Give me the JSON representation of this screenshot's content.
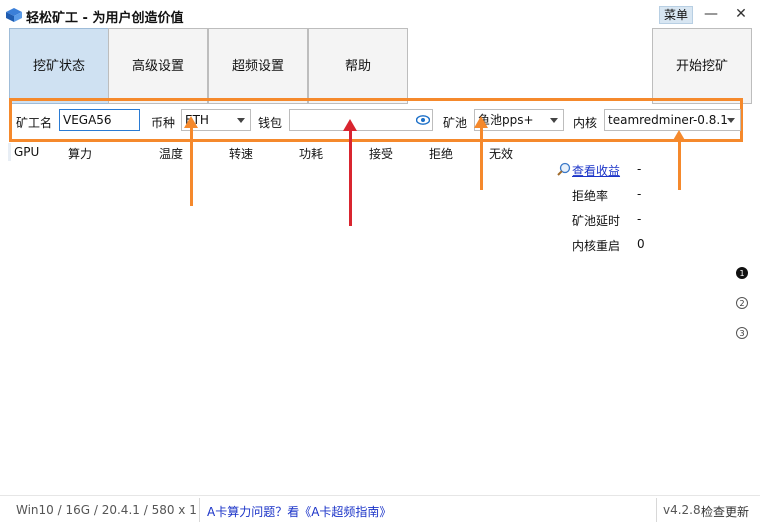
{
  "window": {
    "title": "轻松矿工 - 为用户创造价值",
    "menu_label": "菜单",
    "minimize_label": "—",
    "close_label": "✕"
  },
  "tabs": [
    {
      "label": "挖矿状态",
      "active": true
    },
    {
      "label": "高级设置",
      "active": false
    },
    {
      "label": "超频设置",
      "active": false
    },
    {
      "label": "帮助",
      "active": false
    }
  ],
  "start_button_label": "开始挖矿",
  "params": {
    "worker_label": "矿工名",
    "worker_value": "VEGA56",
    "coin_label": "币种",
    "coin_value": "ETH",
    "wallet_label": "钱包",
    "wallet_value": "",
    "pool_label": "矿池",
    "pool_value": "鱼池pps+",
    "kernel_label": "内核",
    "kernel_value": "teamredminer-0.8.1"
  },
  "table_headers": [
    "GPU",
    "算力",
    "温度",
    "转速",
    "功耗",
    "接受",
    "拒绝",
    "无效"
  ],
  "stats": {
    "view_earnings_label": "查看收益",
    "view_earnings_value": "-",
    "reject_rate_label": "拒绝率",
    "reject_rate_value": "-",
    "pool_latency_label": "矿池延时",
    "pool_latency_value": "-",
    "kernel_restart_label": "内核重启",
    "kernel_restart_value": "0"
  },
  "pager": [
    "1",
    "2",
    "3"
  ],
  "footer": {
    "system_info": "Win10  / 16G / 20.4.1 / 580 x 1",
    "help_link": "A卡算力问题？看《A卡超频指南》",
    "version": "v4.2.8",
    "update_label": "检查更新"
  },
  "colors": {
    "accent_orange": "#f5892c",
    "arrow_red": "#d9252f",
    "active_tab": "#cfe1f2",
    "link": "#1a33c8"
  }
}
